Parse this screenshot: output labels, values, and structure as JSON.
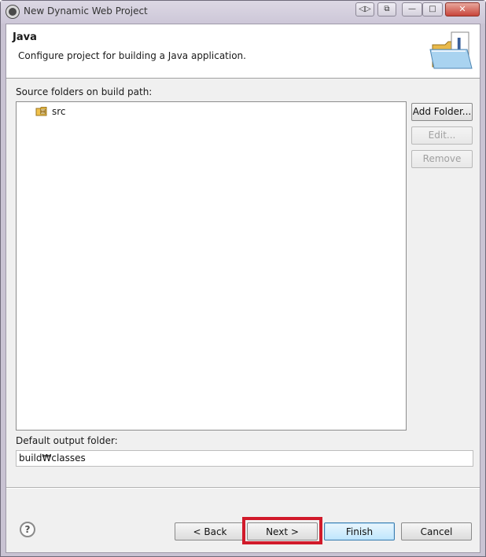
{
  "window": {
    "title": "New Dynamic Web Project",
    "controls": {
      "restore": "◁▷",
      "pin": "⧉",
      "minimize": "—",
      "maximize": "□",
      "close": "✕"
    }
  },
  "header": {
    "title": "Java",
    "description": "Configure project for building a Java application."
  },
  "source": {
    "label": "Source folders on build path:",
    "folders": [
      {
        "name": "src",
        "icon": "source-folder-icon"
      }
    ],
    "buttons": {
      "add": "Add Folder...",
      "edit": "Edit...",
      "remove": "Remove"
    }
  },
  "output": {
    "label": "Default output folder:",
    "value": "build₩classes"
  },
  "footer": {
    "help": "?",
    "back": "< Back",
    "next": "Next >",
    "finish": "Finish",
    "cancel": "Cancel"
  },
  "colors": {
    "highlight": "#d11a2a",
    "accent": "#3c7fb1"
  }
}
